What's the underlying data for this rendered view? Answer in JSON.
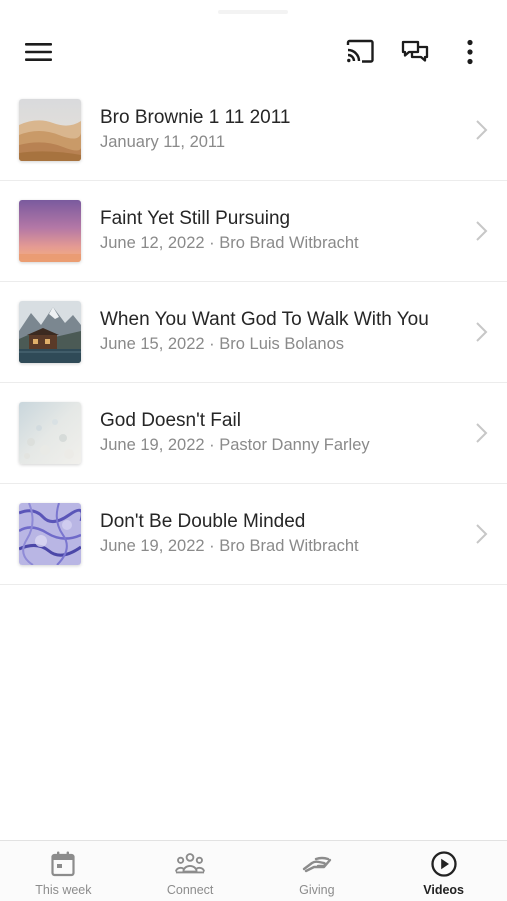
{
  "header": {
    "menu_icon": "hamburger-menu-icon",
    "cast_icon": "cast-icon",
    "chat_icon": "chat-bubbles-icon",
    "more_icon": "more-vertical-icon"
  },
  "videos": [
    {
      "title": "Bro Brownie 1 11 2011",
      "subtitle": "January 11, 2011",
      "thumb": "desert-dunes"
    },
    {
      "title": "Faint Yet Still Pursuing",
      "subtitle": "June 12, 2022 · Bro Brad Witbracht",
      "thumb": "purple-sunset"
    },
    {
      "title": "When You Want God To Walk With You",
      "subtitle": "June 15, 2022 · Bro Luis Bolanos",
      "thumb": "mountain-lake-cabin"
    },
    {
      "title": "God Doesn't Fail",
      "subtitle": "June 19, 2022 · Pastor Danny Farley",
      "thumb": "pale-stone-texture"
    },
    {
      "title": "Don't Be Double Minded",
      "subtitle": "June 19, 2022 · Bro Brad Witbracht",
      "thumb": "blue-marble"
    }
  ],
  "nav": {
    "this_week": "This week",
    "connect": "Connect",
    "giving": "Giving",
    "videos": "Videos",
    "active": "Videos"
  },
  "colors": {
    "accent": "#222222",
    "muted": "#8a8a8a",
    "divider": "#ececec"
  }
}
